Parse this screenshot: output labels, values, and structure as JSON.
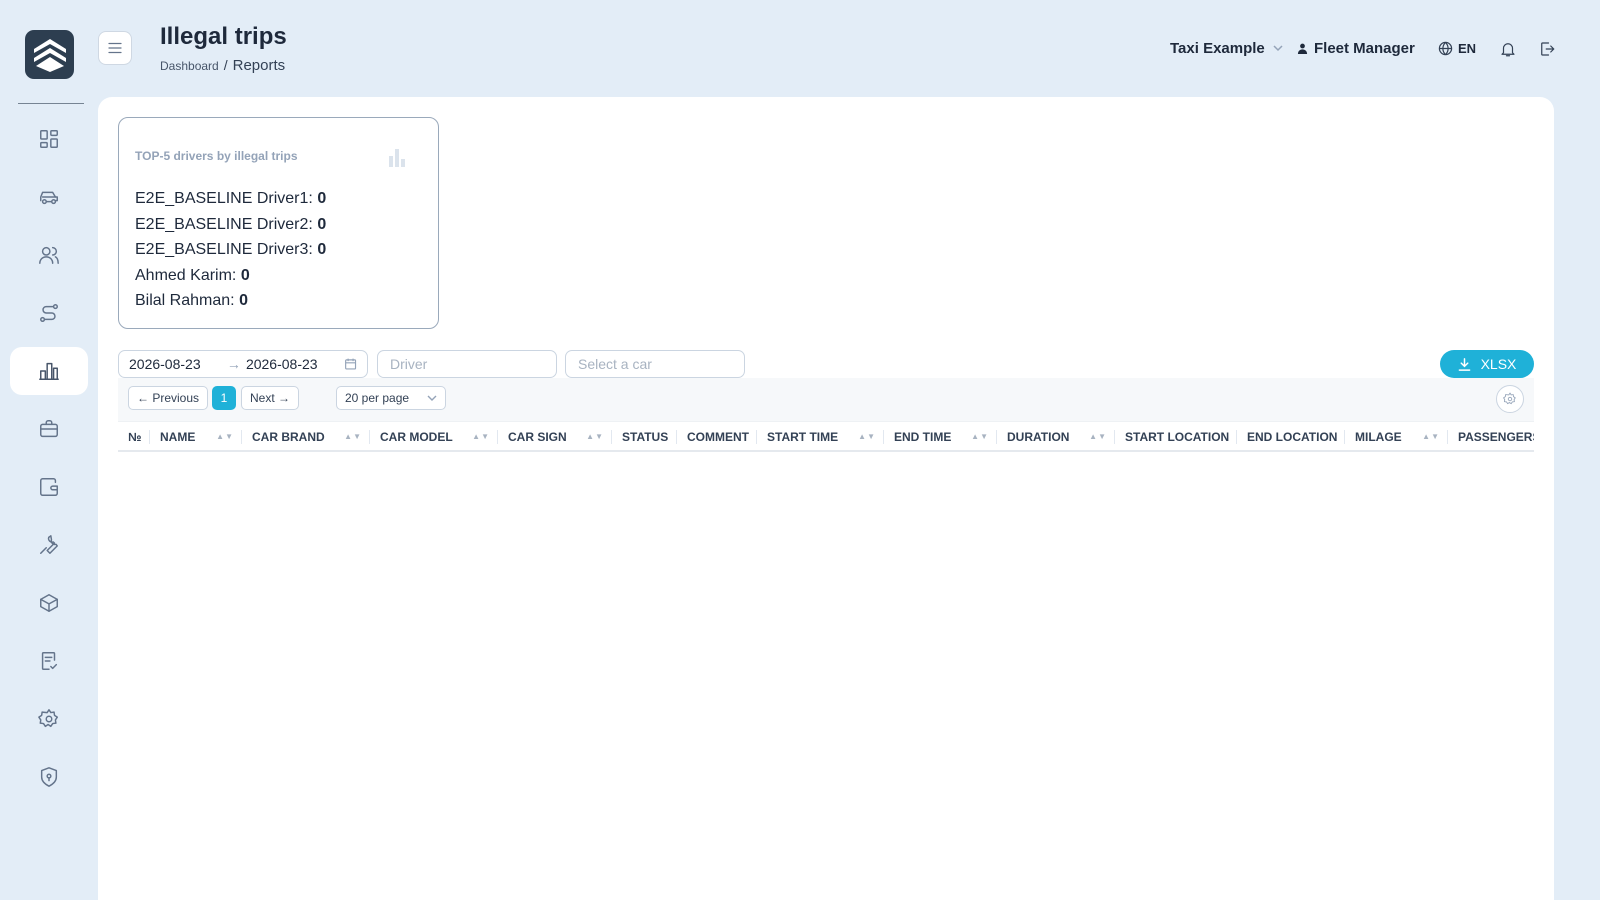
{
  "header": {
    "title": "Illegal trips",
    "breadcrumb": {
      "parent": "Dashboard",
      "separator": "/",
      "current": "Reports"
    },
    "company": "Taxi Example",
    "user": "Fleet Manager",
    "language": "EN"
  },
  "sidebar": {
    "items": [
      {
        "icon": "dashboard-icon"
      },
      {
        "icon": "car-icon"
      },
      {
        "icon": "users-icon"
      },
      {
        "icon": "route-icon"
      },
      {
        "icon": "reports-chart-icon",
        "active": true
      },
      {
        "icon": "briefcase-icon"
      },
      {
        "icon": "wallet-icon"
      },
      {
        "icon": "wrench-icon"
      },
      {
        "icon": "package-icon"
      },
      {
        "icon": "checklist-icon"
      },
      {
        "icon": "gear-icon"
      },
      {
        "icon": "shield-icon"
      }
    ]
  },
  "top5": {
    "title": "TOP-5 drivers by illegal trips",
    "drivers": [
      {
        "name": "E2E_BASELINE Driver1:",
        "count": "0"
      },
      {
        "name": "E2E_BASELINE Driver2:",
        "count": "0"
      },
      {
        "name": "E2E_BASELINE Driver3:",
        "count": "0"
      },
      {
        "name": "Ahmed Karim:",
        "count": "0"
      },
      {
        "name": "Bilal Rahman:",
        "count": "0"
      }
    ]
  },
  "filters": {
    "date_from": "2026-08-23",
    "date_arrow": "→",
    "date_to": "2026-08-23",
    "driver_placeholder": "Driver",
    "car_placeholder": "Select a car",
    "export_label": "XLSX"
  },
  "pagination": {
    "previous": "← Previous",
    "current_page": "1",
    "next": "Next →",
    "per_page": "20 per page"
  },
  "table": {
    "columns": [
      {
        "label": "№",
        "sortable": false
      },
      {
        "label": "NAME",
        "sortable": true
      },
      {
        "label": "CAR BRAND",
        "sortable": true
      },
      {
        "label": "CAR MODEL",
        "sortable": true
      },
      {
        "label": "CAR SIGN",
        "sortable": true
      },
      {
        "label": "STATUS",
        "sortable": false
      },
      {
        "label": "COMMENT",
        "sortable": false
      },
      {
        "label": "START TIME",
        "sortable": true
      },
      {
        "label": "END TIME",
        "sortable": true
      },
      {
        "label": "DURATION",
        "sortable": true
      },
      {
        "label": "START LOCATION",
        "sortable": false
      },
      {
        "label": "END LOCATION",
        "sortable": false
      },
      {
        "label": "MILAGE",
        "sortable": true
      },
      {
        "label": "PASSENGERS",
        "sortable": false
      }
    ],
    "rows": []
  },
  "colors": {
    "background": "#e3edf7",
    "accent": "#1fb1d8",
    "sidebar_logo": "#2d3e50"
  }
}
